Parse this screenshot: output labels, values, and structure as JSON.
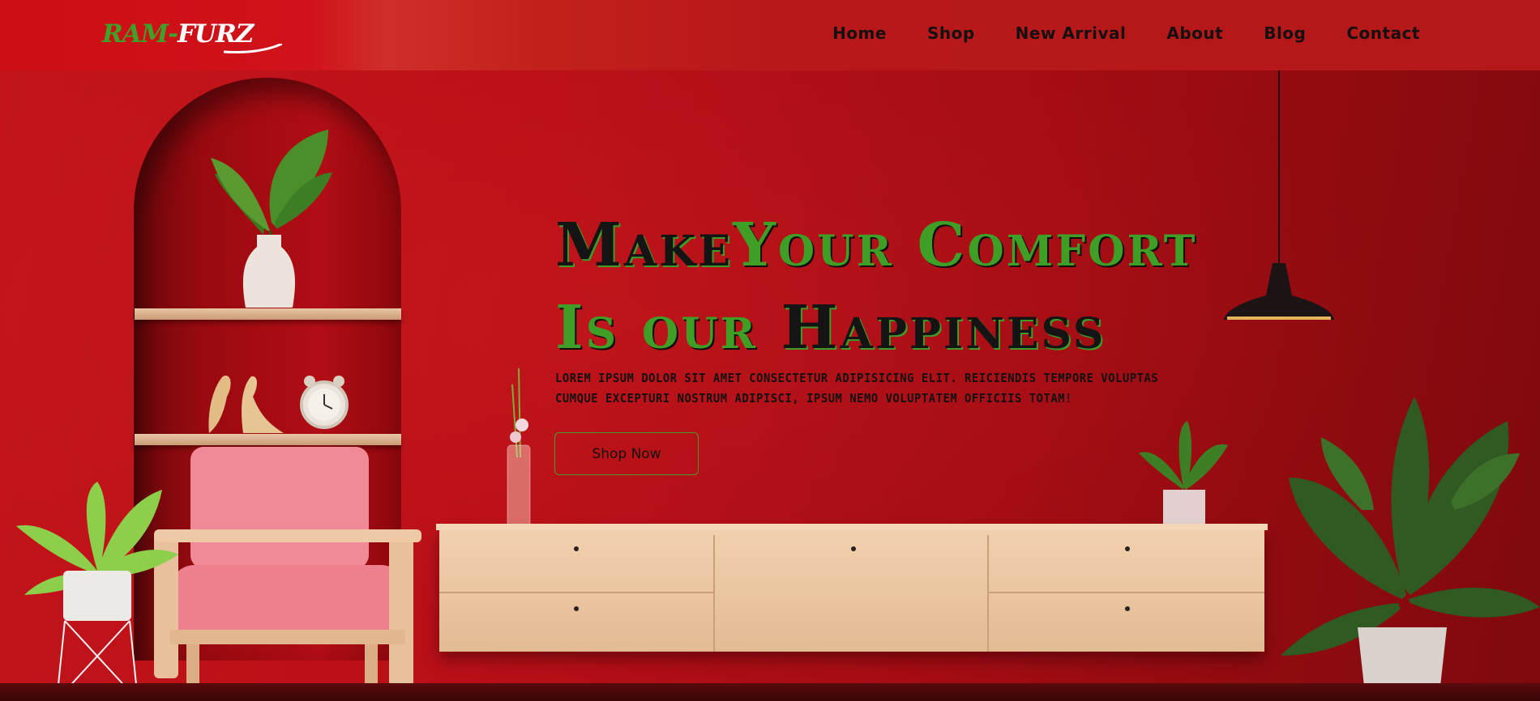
{
  "brand": {
    "logo_part1": "RAM-",
    "logo_part2": "FURZ"
  },
  "nav": {
    "items": [
      {
        "label": "Home"
      },
      {
        "label": "Shop"
      },
      {
        "label": "New Arrival"
      },
      {
        "label": "About"
      },
      {
        "label": "Blog"
      },
      {
        "label": "Contact"
      }
    ]
  },
  "hero": {
    "title_line1_part1": "Make",
    "title_line1_part2": "Your Comfort",
    "title_line2_part1": "Is our ",
    "title_line2_part2": "Happiness",
    "subtitle": "Lorem ipsum dolor sit amet consectetur adipisicing elit. Reiciendis tempore voluptas cumque excepturi nostrum adipisci, ipsum nemo voluptatem officiis totam!",
    "cta_label": "Shop Now"
  },
  "colors": {
    "brand_green": "#3f9e26",
    "header_red": "#cc0e14",
    "wall_red": "#b90f17"
  }
}
